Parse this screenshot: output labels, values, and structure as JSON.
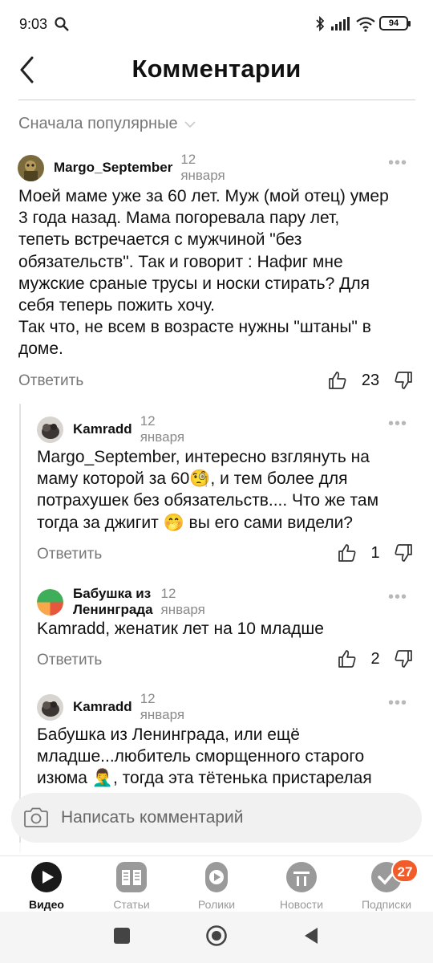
{
  "status_bar": {
    "time": "9:03",
    "battery": "94"
  },
  "header": {
    "title": "Комментарии"
  },
  "sort": {
    "label": "Сначала популярные"
  },
  "comments": [
    {
      "author": "Margo_September",
      "date": "12 января",
      "text_lines": [
        "Моей маме уже за 60 лет. Муж (мой отец) умер",
        "3 года назад. Мама погоревала пару лет,",
        "тепеть встречается с мужчиной \"без",
        "обязательств\". Так и говорит : Нафиг мне",
        "мужские сраные трусы и носки стирать? Для",
        "себя теперь пожить хочу.",
        "Так что, не всем в возрасте нужны \"штаны\" в",
        "доме."
      ],
      "reply": "Ответить",
      "likes": "23"
    },
    {
      "author": "Kamradd",
      "date": "12 января",
      "text_lines": [
        "Margo_September, интересно взглянуть на",
        "маму которой за 60🧐, и тем более для",
        "потрахушек без обязательств.... Что же там",
        "тогда за джигит 🤭 вы его сами видели?"
      ],
      "reply": "Ответить",
      "likes": "1"
    },
    {
      "author": "Бабушка из Ленинграда",
      "date": "12 января",
      "text_lines": [
        "Kamradd, женатик лет на 10 младше"
      ],
      "reply": "Ответить",
      "likes": "2"
    },
    {
      "author": "Kamradd",
      "date": "12 января",
      "text_lines": [
        "Бабушка из Ленинграда, или ещё",
        "младше...любитель сморщенного старого",
        "изюма 🤦‍♂️, тогда эта тётенька пристарелая"
      ]
    }
  ],
  "comment_input": {
    "placeholder": "Написать комментарий"
  },
  "bottom_nav": {
    "items": [
      {
        "label": "Видео",
        "icon": "video-play-icon",
        "active": true
      },
      {
        "label": "Статьи",
        "icon": "articles-icon"
      },
      {
        "label": "Ролики",
        "icon": "shorts-icon"
      },
      {
        "label": "Новости",
        "icon": "news-icon"
      },
      {
        "label": "Подписки",
        "icon": "subscriptions-icon"
      }
    ],
    "subscriptions_badge": "27"
  },
  "colors": {
    "accent": "#f25c2b",
    "text": "#111111",
    "muted": "#8a8a8a"
  }
}
